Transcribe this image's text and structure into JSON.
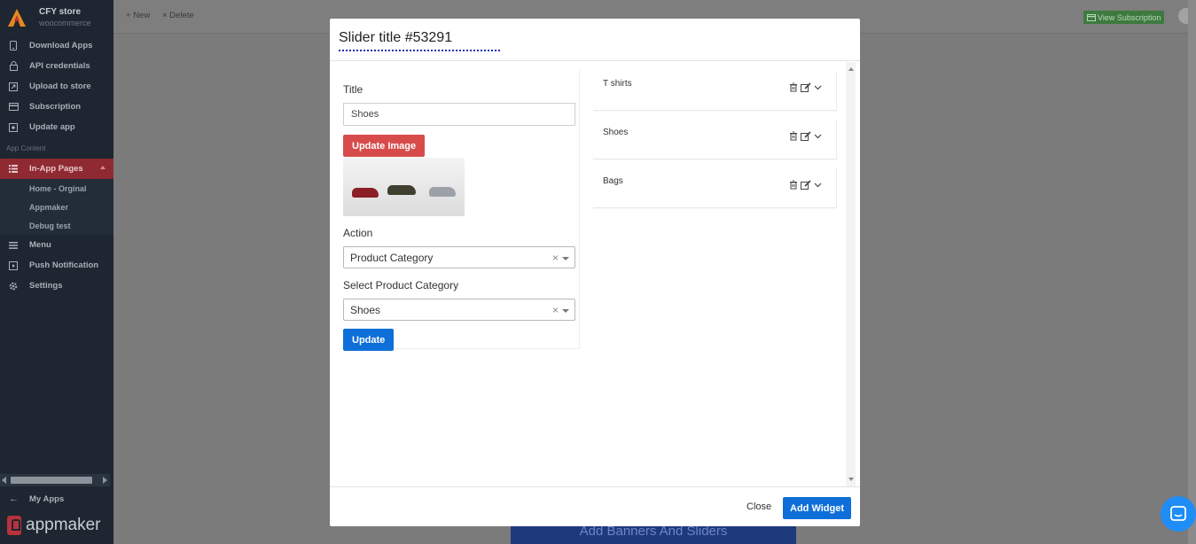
{
  "sidebar": {
    "store_name": "CFY store",
    "store_type": "woocommerce",
    "items": [
      {
        "label": "Download Apps",
        "icon": "phone-icon"
      },
      {
        "label": "API credentials",
        "icon": "lock-icon"
      },
      {
        "label": "Upload to store",
        "icon": "external-link-icon"
      },
      {
        "label": "Subscription",
        "icon": "credit-card-icon"
      },
      {
        "label": "Update app",
        "icon": "upload-box-icon"
      }
    ],
    "section_label": "App Content",
    "active_item": {
      "label": "In-App Pages",
      "icon": "list-icon"
    },
    "sub_items": [
      "Home - Orginal",
      "Appmaker",
      "Debug test"
    ],
    "lower_items": [
      {
        "label": "Menu",
        "icon": "menu-icon"
      },
      {
        "label": "Push Notification",
        "icon": "bell-box-icon"
      },
      {
        "label": "Settings",
        "icon": "gear-icon"
      }
    ],
    "my_apps": "My Apps",
    "footer_brand": "appmaker",
    "accent_color": "#8f2a33"
  },
  "topbar": {
    "new_label": "+ New",
    "delete_label": "× Delete",
    "view_subscription_label": "View Subscription"
  },
  "background": {
    "banner_label": "Add Banners And Sliders"
  },
  "modal": {
    "title": "Slider title #53291",
    "form": {
      "title_label": "Title",
      "title_value": "Shoes",
      "update_image_label": "Update Image",
      "action_label": "Action",
      "action_value": "Product Category",
      "category_label": "Select Product Category",
      "category_value": "Shoes",
      "update_label": "Update"
    },
    "slides": [
      "T shirts",
      "Shoes",
      "Bags"
    ],
    "close_label": "Close",
    "add_widget_label": "Add Widget",
    "primary_color": "#0f6fd8",
    "danger_color": "#d84b4b"
  }
}
